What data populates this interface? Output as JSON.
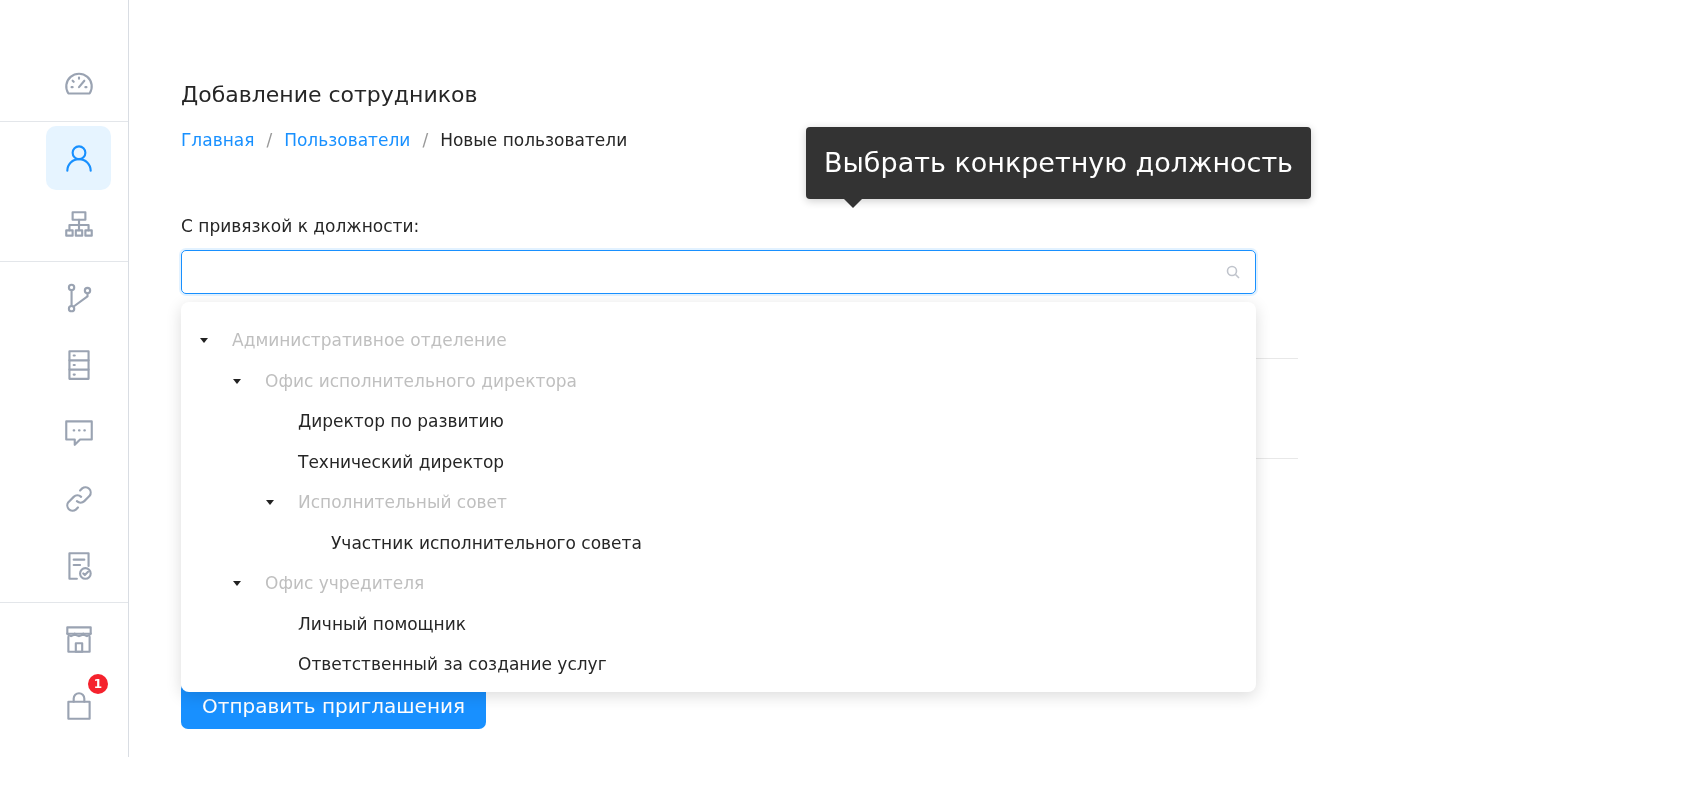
{
  "sidebar": {
    "groups": [
      [
        {
          "selected": false
        }
      ],
      [
        {
          "selected": true
        },
        {
          "selected": false
        }
      ],
      [
        {
          "selected": false
        },
        {
          "selected": false
        },
        {
          "selected": false
        },
        {
          "selected": false
        },
        {
          "selected": false
        }
      ],
      [
        {
          "selected": false
        },
        {
          "selected": false,
          "badge": "1"
        }
      ]
    ]
  },
  "page_title": "Добавление сотрудников",
  "breadcrumb": {
    "separator": "/",
    "items": [
      {
        "label": "Главная",
        "link": true
      },
      {
        "label": "Пользователи",
        "link": true
      },
      {
        "label": "Новые пользователи",
        "link": false
      }
    ]
  },
  "tooltip": "Выбрать конкретную должность",
  "position_field": {
    "label": "С привязкой к должности:"
  },
  "position_tree": [
    {
      "label": "Административное отделение",
      "expanded": true,
      "disabled": true,
      "children": [
        {
          "label": "Офис исполнительного директора",
          "expanded": true,
          "disabled": true,
          "children": [
            {
              "label": "Директор по развитию",
              "disabled": false
            },
            {
              "label": "Технический директор",
              "disabled": false
            },
            {
              "label": "Исполнительный совет",
              "expanded": true,
              "disabled": true,
              "children": [
                {
                  "label": "Участник исполнительного совета",
                  "disabled": false
                }
              ]
            }
          ]
        },
        {
          "label": "Офис учредителя",
          "expanded": true,
          "disabled": true,
          "children": [
            {
              "label": "Личный помощник",
              "disabled": false
            },
            {
              "label": "Ответственный за создание услуг",
              "disabled": false
            }
          ]
        }
      ]
    }
  ],
  "submit_button": "Отправить приглашения"
}
